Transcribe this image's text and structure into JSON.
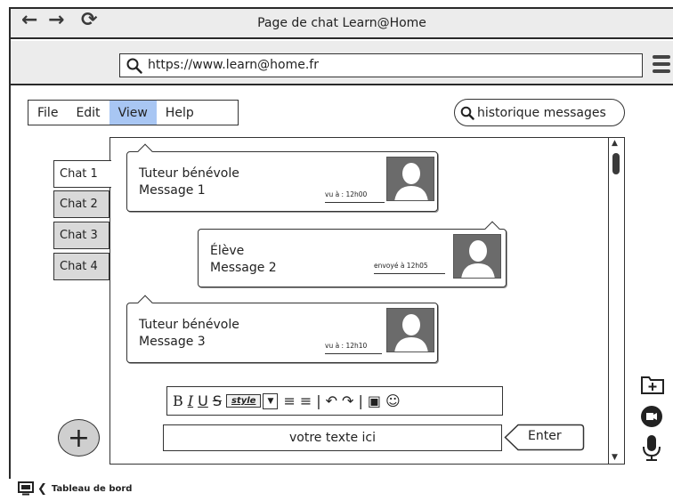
{
  "window": {
    "title": "Page de chat Learn@Home",
    "url": "https://www.learn@home.fr"
  },
  "menu": {
    "items": [
      {
        "label": "File"
      },
      {
        "label": "Edit"
      },
      {
        "label": "View",
        "active": true
      },
      {
        "label": "Help"
      }
    ]
  },
  "search": {
    "label": "historique messages"
  },
  "tabs": [
    {
      "label": "Chat 1",
      "active": true
    },
    {
      "label": "Chat 2"
    },
    {
      "label": "Chat 3"
    },
    {
      "label": "Chat 4"
    }
  ],
  "messages": [
    {
      "sender": "Tuteur bénévole",
      "text": "Message 1",
      "status": "vu à : 12h00"
    },
    {
      "sender": "Élève",
      "text": "Message 2",
      "status": "envoyé à 12h05"
    },
    {
      "sender": "Tuteur bénévole",
      "text": "Message 3",
      "status": "vu à : 12h10"
    }
  ],
  "editor": {
    "style_label": "style",
    "input_value": "votre texte ici",
    "enter_label": "Enter"
  },
  "footer": {
    "label": "Tableau de bord"
  },
  "colors": {
    "active_menu": "#a8c6f3",
    "chrome": "#ececec",
    "inactive_tab": "#d9d9d9",
    "avatar": "#6b6b6b"
  },
  "icons": [
    "back-arrow-icon",
    "forward-arrow-icon",
    "refresh-icon",
    "search-icon",
    "menu-icon",
    "add-icon",
    "bold-icon",
    "italic-icon",
    "underline-icon",
    "strikethrough-icon",
    "bullet-list-icon",
    "numbered-list-icon",
    "undo-icon",
    "redo-icon",
    "image-icon",
    "emoji-icon",
    "add-folder-icon",
    "video-icon",
    "microphone-icon",
    "dashboard-icon",
    "chevron-left-icon"
  ]
}
